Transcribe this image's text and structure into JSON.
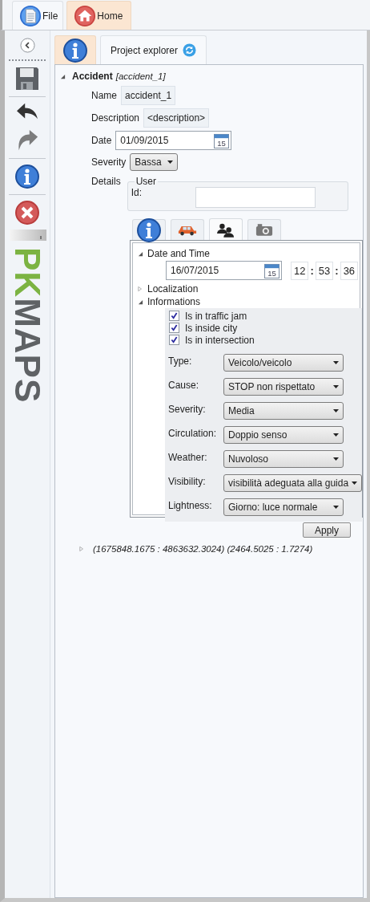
{
  "ribbon_tabs": [
    {
      "label": "File",
      "selected": false
    },
    {
      "label": "Home",
      "selected": true
    }
  ],
  "toolbar": [
    {
      "kind": "back",
      "disabled": false
    },
    {
      "kind": "save",
      "disabled": false
    },
    {
      "kind": "undo",
      "disabled": false
    },
    {
      "kind": "redo",
      "disabled": true
    },
    {
      "kind": "info",
      "disabled": false
    },
    {
      "kind": "close",
      "disabled": false
    },
    {
      "kind": "grip",
      "disabled": false
    }
  ],
  "logo": [
    {
      "text": "PK",
      "color": "#7cb342"
    },
    {
      "text": "MAPS",
      "color": "#5f6265"
    }
  ],
  "panel_tabs": [
    {
      "kind": "icon",
      "selected": true
    },
    {
      "kind": "text",
      "label": "Project explorer",
      "selected": false
    }
  ],
  "accident": {
    "title": "Accident",
    "tag": "[accident_1]",
    "expanded": true,
    "name": {
      "label": "Name",
      "value": "accident_1"
    },
    "description": {
      "label": "Description",
      "value": "<description>"
    },
    "date": {
      "label": "Date",
      "value": "01/09/2015",
      "calendar_day": "15"
    },
    "severity": {
      "label": "Severity",
      "value": "Bassa"
    },
    "details": {
      "label": "Details",
      "group": "User",
      "id_label": "Id:"
    }
  },
  "detail_tabs": [
    {
      "selected": false
    },
    {
      "selected": false
    },
    {
      "selected": true
    },
    {
      "selected": false
    }
  ],
  "sections": [
    {
      "kind": "datetime",
      "title": "Date and Time",
      "expanded": true,
      "date": "16/07/2015",
      "calendar_day": "15",
      "time": [
        "12",
        "53",
        "36"
      ],
      "separators": [
        ":",
        ":"
      ]
    },
    {
      "kind": "plain",
      "title": "Localization",
      "expanded": false
    },
    {
      "kind": "info",
      "title": "Informations",
      "expanded": true,
      "checks": [
        {
          "label": "Is in traffic jam",
          "checked": true
        },
        {
          "label": "Is inside city",
          "checked": true
        },
        {
          "label": "Is in intersection",
          "checked": true
        }
      ],
      "combos": [
        {
          "label": "Type:",
          "value": "Veicolo/veicolo"
        },
        {
          "label": "Cause:",
          "value": "STOP non rispettato"
        },
        {
          "label": "Severity:",
          "value": "Media"
        },
        {
          "label": "Circulation:",
          "value": "Doppio senso"
        },
        {
          "label": "Weather:",
          "value": "Nuvoloso"
        },
        {
          "label": "Visibility:",
          "value": "visibilità adeguata alla guida"
        },
        {
          "label": "Lightness:",
          "value": "Giorno: luce normale"
        }
      ]
    }
  ],
  "apply_button": "Apply",
  "coordinates": {
    "expanded": false,
    "text": "(1675848.1675 : 4863632.3024) (2464.5025 : 1.7274)"
  }
}
